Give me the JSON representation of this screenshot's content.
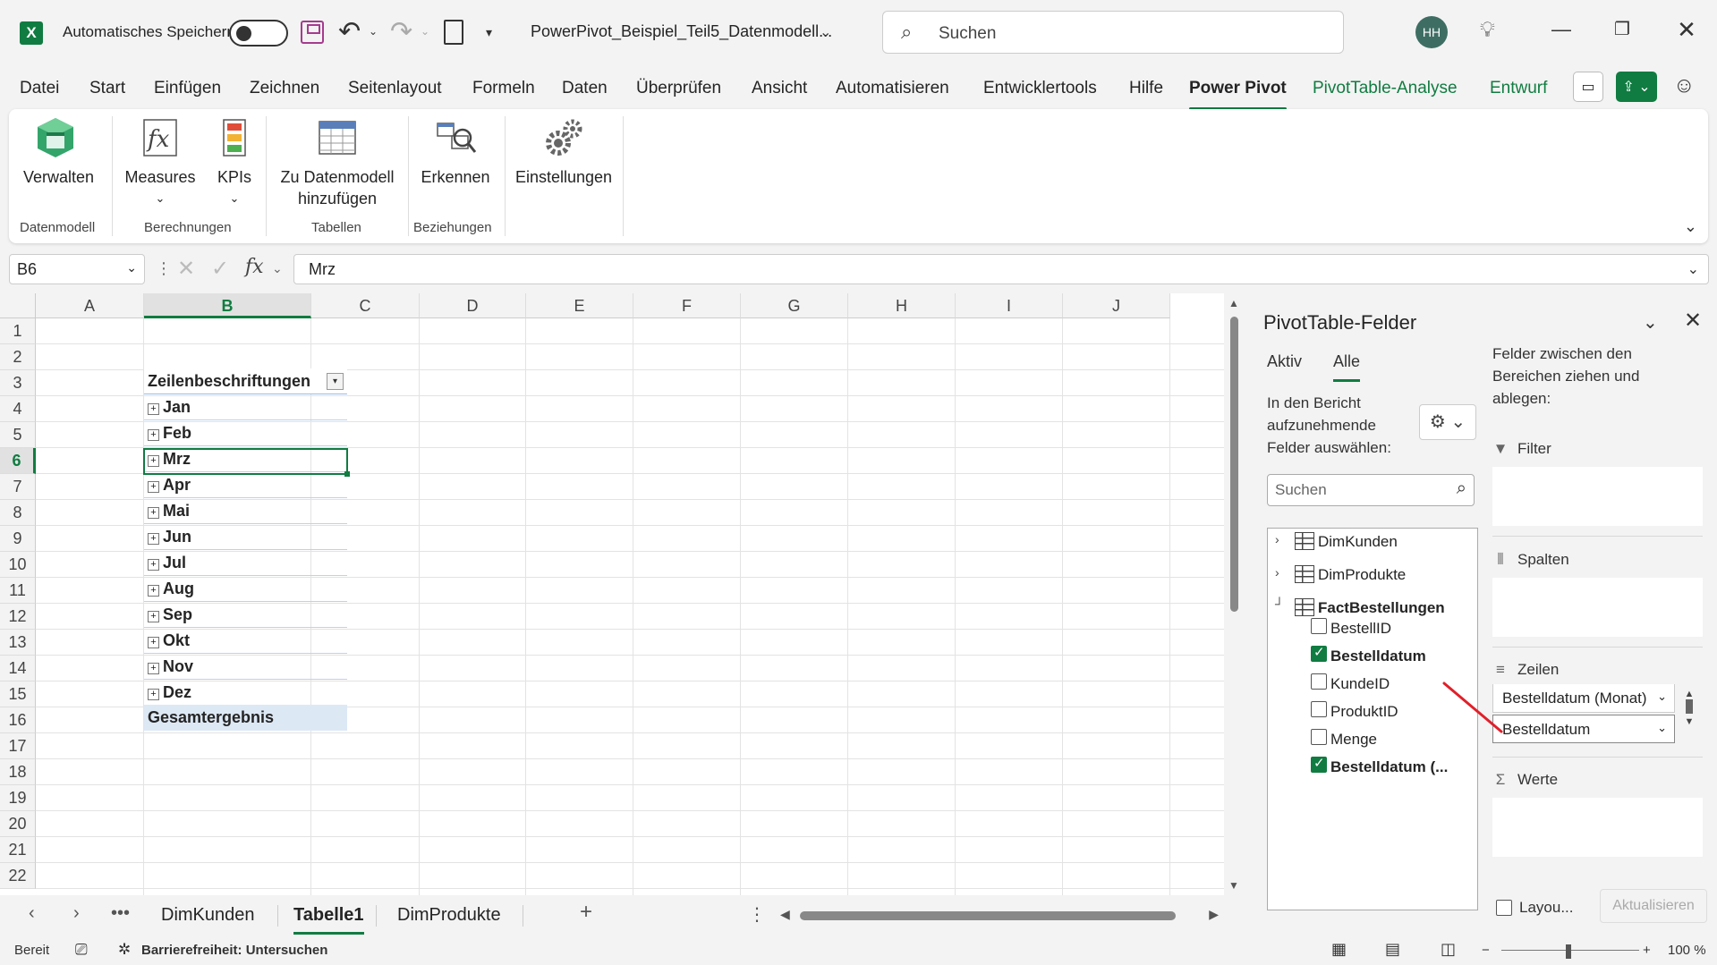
{
  "titlebar": {
    "app_icon": "excel-icon",
    "autosave_label": "Automatisches Speichern",
    "file_title": "PowerPivot_Beispiel_Teil5_Datenmodell...",
    "search_placeholder": "Suchen",
    "avatar_initials": "HH"
  },
  "ribbon_tabs": [
    "Datei",
    "Start",
    "Einfügen",
    "Zeichnen",
    "Seitenlayout",
    "Formeln",
    "Daten",
    "Überprüfen",
    "Ansicht",
    "Automatisieren",
    "Entwicklertools",
    "Hilfe",
    "Power Pivot",
    "PivotTable-Analyse",
    "Entwurf"
  ],
  "ribbon": {
    "verwalten": "Verwalten",
    "measures": "Measures",
    "kpis": "KPIs",
    "zu_datenmodell_1": "Zu Datenmodell",
    "zu_datenmodell_2": "hinzufügen",
    "erkennen": "Erkennen",
    "einstellungen": "Einstellungen",
    "groups": {
      "datenmodell": "Datenmodell",
      "berechnungen": "Berechnungen",
      "tabellen": "Tabellen",
      "beziehungen": "Beziehungen"
    }
  },
  "formula_bar": {
    "name_box": "B6",
    "value": "Mrz"
  },
  "grid": {
    "columns": [
      "A",
      "B",
      "C",
      "D",
      "E",
      "F",
      "G",
      "H",
      "I",
      "J"
    ],
    "rows": [
      "1",
      "2",
      "3",
      "4",
      "5",
      "6",
      "7",
      "8",
      "9",
      "10",
      "11",
      "12",
      "13",
      "14",
      "15",
      "16",
      "17",
      "18",
      "19",
      "20",
      "21",
      "22"
    ],
    "selected_column": "B",
    "selected_row": "6"
  },
  "pivot": {
    "header": "Zeilenbeschriftungen",
    "items": [
      "Jan",
      "Feb",
      "Mrz",
      "Apr",
      "Mai",
      "Jun",
      "Jul",
      "Aug",
      "Sep",
      "Okt",
      "Nov",
      "Dez"
    ],
    "total": "Gesamtergebnis"
  },
  "sheet_tabs": {
    "tabs": [
      "DimKunden",
      "Tabelle1",
      "DimProdukte"
    ],
    "active": "Tabelle1"
  },
  "status_bar": {
    "ready": "Bereit",
    "accessibility": "Barrierefreiheit: Untersuchen",
    "zoom": "100 %"
  },
  "pivot_pane": {
    "title": "PivotTable-Felder",
    "tab_active": "Aktiv",
    "tab_all": "Alle",
    "instruction_1": "In den Bericht",
    "instruction_2": "aufzunehmende",
    "instruction_3": "Felder auswählen:",
    "search_placeholder": "Suchen",
    "tables": [
      {
        "name": "DimKunden",
        "expanded": false
      },
      {
        "name": "DimProdukte",
        "expanded": false
      },
      {
        "name": "FactBestellungen",
        "expanded": true
      }
    ],
    "fields": [
      {
        "name": "BestellID",
        "checked": false
      },
      {
        "name": "Bestelldatum",
        "checked": true
      },
      {
        "name": "KundeID",
        "checked": false
      },
      {
        "name": "ProduktID",
        "checked": false
      },
      {
        "name": "Menge",
        "checked": false
      },
      {
        "name": "Bestelldatum (...",
        "checked": true
      }
    ],
    "areas_instruction_1": "Felder zwischen den",
    "areas_instruction_2": "Bereichen ziehen und",
    "areas_instruction_3": "ablegen:",
    "filter": "Filter",
    "columns": "Spalten",
    "rows": "Zeilen",
    "values": "Werte",
    "row_fields": [
      "Bestelldatum (Monat)",
      "Bestelldatum"
    ],
    "layout_label": "Layou...",
    "update_button": "Aktualisieren"
  },
  "colors": {
    "accent": "#107c41",
    "annotation": "#e0202a"
  }
}
